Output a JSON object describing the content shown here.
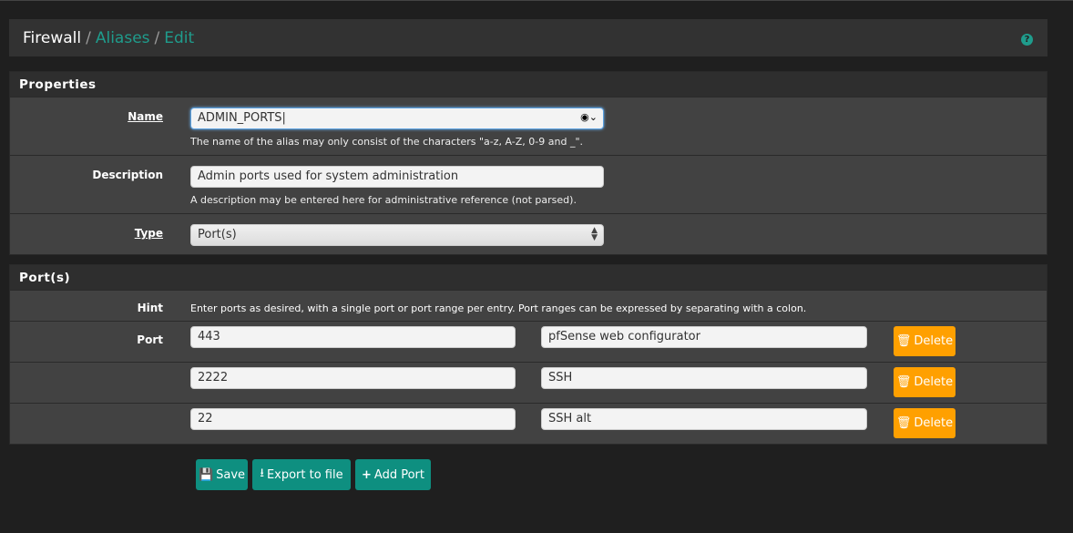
{
  "breadcrumb": {
    "root": "Firewall",
    "aliases": "Aliases",
    "edit": "Edit"
  },
  "properties": {
    "title": "Properties",
    "name_label": "Name",
    "name_value": "ADMIN_PORTS",
    "name_help": "The name of the alias may only consist of the characters \"a-z, A-Z, 0-9 and _\".",
    "description_label": "Description",
    "description_value": "Admin ports used for system administration",
    "description_help": "A description may be entered here for administrative reference (not parsed).",
    "type_label": "Type",
    "type_value": "Port(s)"
  },
  "ports": {
    "title": "Port(s)",
    "hint_label": "Hint",
    "hint_text": "Enter ports as desired, with a single port or port range per entry. Port ranges can be expressed by separating with a colon.",
    "port_label": "Port",
    "delete_label": "Delete",
    "rows": [
      {
        "port": "443",
        "description": "pfSense web configurator"
      },
      {
        "port": "2222",
        "description": "SSH"
      },
      {
        "port": "22",
        "description": "SSH alt"
      }
    ]
  },
  "actions": {
    "save": "Save",
    "export": "Export to file",
    "add_port": "Add Port"
  },
  "colors": {
    "accent": "#0e8f80",
    "link": "#1f9c8c",
    "delete": "#ffa000"
  }
}
